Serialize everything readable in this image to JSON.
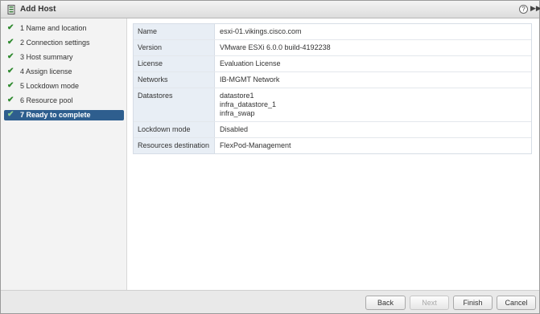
{
  "window": {
    "title": "Add Host"
  },
  "steps": [
    {
      "label": "1  Name and location",
      "done": true
    },
    {
      "label": "2  Connection settings",
      "done": true
    },
    {
      "label": "3  Host summary",
      "done": true
    },
    {
      "label": "4  Assign license",
      "done": true
    },
    {
      "label": "5  Lockdown mode",
      "done": true
    },
    {
      "label": "6  Resource pool",
      "done": true
    },
    {
      "label": "7  Ready to complete",
      "done": true,
      "active": true
    }
  ],
  "summary": {
    "name": {
      "key": "Name",
      "value": "esxi-01.vikings.cisco.com"
    },
    "version": {
      "key": "Version",
      "value": "VMware ESXi 6.0.0 build-4192238"
    },
    "license": {
      "key": "License",
      "value": "Evaluation License"
    },
    "networks": {
      "key": "Networks",
      "value": "IB-MGMT Network"
    },
    "datastores": {
      "key": "Datastores",
      "values": [
        "datastore1",
        "infra_datastore_1",
        "infra_swap"
      ]
    },
    "lockdown": {
      "key": "Lockdown mode",
      "value": "Disabled"
    },
    "resources": {
      "key": "Resources destination",
      "value": "FlexPod-Management"
    }
  },
  "buttons": {
    "back": "Back",
    "next": "Next",
    "finish": "Finish",
    "cancel": "Cancel"
  },
  "colors": {
    "active_step": "#2e5e8e",
    "check": "#2f8a2f",
    "key_cell": "#e8eef5"
  },
  "icons": {
    "help": "help-icon",
    "expand": "expand-icon",
    "check": "checkmark-icon"
  }
}
